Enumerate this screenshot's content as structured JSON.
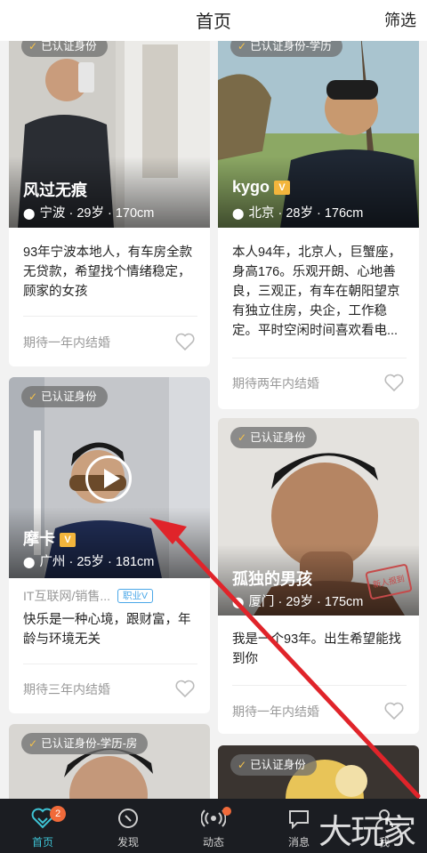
{
  "header": {
    "title": "首页",
    "filter_label": "筛选"
  },
  "colors": {
    "accent": "#3ec4d6",
    "badge_dot": "#f06a3a",
    "vip": "#f3b53c",
    "arrow": "#e0242a",
    "nav_bg": "#1b1d22"
  },
  "cards": [
    {
      "badge": "已认证身份",
      "name": "风过无痕",
      "location": "宁波",
      "age": "29岁",
      "height": "170cm",
      "desc": "93年宁波本地人，有车房全款无贷款，希望找个情绪稳定，顾家的女孩",
      "plan": "期待一年内结婚"
    },
    {
      "badge": "已认证身份-学历",
      "name": "kygo",
      "vip": "V",
      "location": "北京",
      "age": "28岁",
      "height": "176cm",
      "desc": "本人94年，北京人，巨蟹座，身高176。乐观开朗、心地善良，三观正，有车在朝阳望京有独立住房，央企，工作稳定。平时空闲时间喜欢看电...",
      "plan": "期待两年内结婚"
    },
    {
      "badge": "已认证身份",
      "name": "摩卡",
      "vip": "V",
      "location": "广州",
      "age": "25岁",
      "height": "181cm",
      "job": "IT互联网/销售...",
      "job_tag": "职业V",
      "desc": "快乐是一种心境，跟财富，年龄与环境无关",
      "plan": "期待三年内结婚"
    },
    {
      "badge": "已认证身份",
      "name": "孤独的男孩",
      "location": "厦门",
      "age": "29岁",
      "height": "175cm",
      "stamp": "新人报到",
      "desc": "我是一个93年。出生希望能找到你",
      "plan": "期待一年内结婚"
    },
    {
      "badge": "已认证身份-学历-房"
    },
    {
      "badge": "已认证身份"
    }
  ],
  "nav": [
    {
      "label": "首页",
      "icon": "heart-icon",
      "badge": "2"
    },
    {
      "label": "发现",
      "icon": "compass-icon"
    },
    {
      "label": "动态",
      "icon": "broadcast-icon"
    },
    {
      "label": "消息",
      "icon": "message-icon"
    },
    {
      "label": "我",
      "icon": "user-icon"
    }
  ],
  "watermark": "大玩家"
}
